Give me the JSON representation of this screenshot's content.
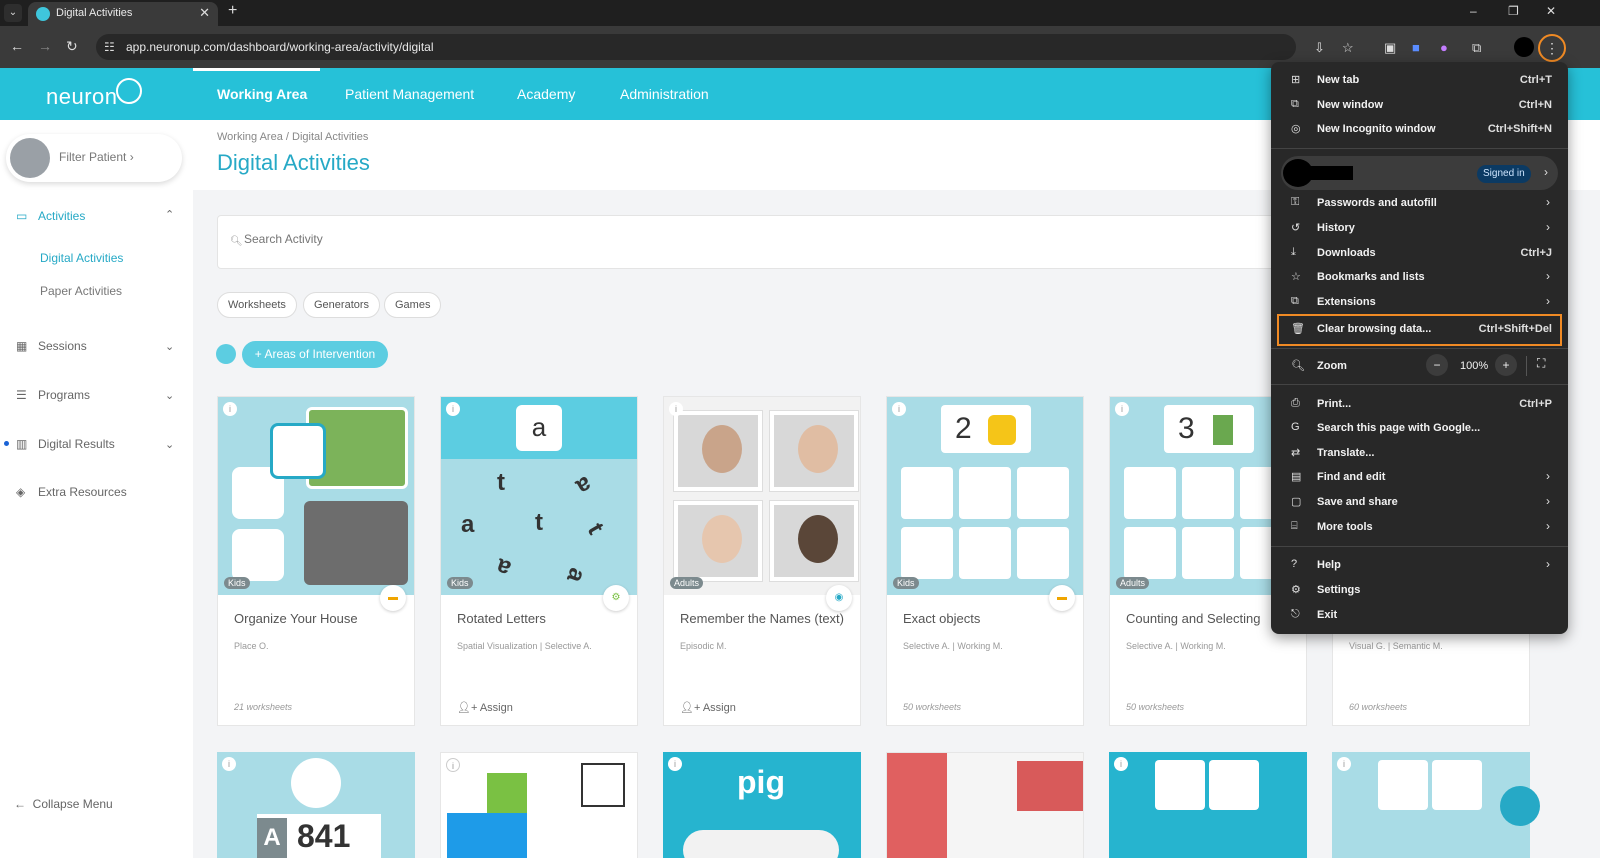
{
  "browser": {
    "tab_title": "Digital Activities",
    "tab_close": "✕",
    "new_tab": "+",
    "url": "app.neuronup.com/dashboard/working-area/activity/digital",
    "window": {
      "minimize": "–",
      "restore": "❐",
      "close": "✕"
    }
  },
  "app": {
    "logo": "neuron",
    "nav": [
      "Working Area",
      "Patient Management",
      "Academy",
      "Administration"
    ]
  },
  "sidebar": {
    "filter_patient": "Filter Patient  ›",
    "activities": "Activities",
    "sub": [
      "Digital Activities",
      "Paper Activities"
    ],
    "sessions": "Sessions",
    "programs": "Programs",
    "digital_results": "Digital Results",
    "extra_resources": "Extra Resources",
    "collapse": "Collapse Menu"
  },
  "main": {
    "breadcrumb": "Working Area /  Digital Activities",
    "title": "Digital Activities",
    "search_placeholder": "Search Activity",
    "chips": [
      "Worksheets",
      "Generators",
      "Games"
    ],
    "areas_button": "+ Areas of Intervention"
  },
  "cards": [
    {
      "title": "Organize Your House",
      "sub": "Place O.",
      "age": "Kids",
      "foot": "21 worksheets"
    },
    {
      "title": "Rotated Letters",
      "sub": "Spatial Visualization | Selective A.",
      "age": "Kids",
      "foot": "Assign"
    },
    {
      "title": "Remember the Names (text)",
      "sub": "Episodic M.",
      "age": "Adults",
      "foot": "Assign"
    },
    {
      "title": "Exact objects",
      "sub": "Selective A. | Working M.",
      "age": "Kids",
      "foot": "50 worksheets"
    },
    {
      "title": "Counting and Selecting",
      "sub": "Selective A. | Working M.",
      "age": "Adults",
      "foot": "50 worksheets"
    },
    {
      "title": "",
      "sub": "Visual G. | Semantic M.",
      "age": "",
      "foot": "60 worksheets"
    }
  ],
  "card_art": {
    "letter_a": "a",
    "number_2": "2",
    "number_3": "3",
    "pig": "pig",
    "num_841": "841",
    "letter_A": "A"
  },
  "menu": {
    "items_top": [
      {
        "label": "New tab",
        "shortcut": "Ctrl+T",
        "icon": "new-tab-icon"
      },
      {
        "label": "New window",
        "shortcut": "Ctrl+N",
        "icon": "new-window-icon"
      },
      {
        "label": "New Incognito window",
        "shortcut": "Ctrl+Shift+N",
        "icon": "incognito-icon"
      }
    ],
    "signed_in": "Signed in",
    "items_mid": [
      {
        "label": "Passwords and autofill",
        "shortcut": "›"
      },
      {
        "label": "History",
        "shortcut": "›"
      },
      {
        "label": "Downloads",
        "shortcut": "Ctrl+J"
      },
      {
        "label": "Bookmarks and lists",
        "shortcut": "›"
      },
      {
        "label": "Extensions",
        "shortcut": "›"
      },
      {
        "label": "Clear browsing data...",
        "shortcut": "Ctrl+Shift+Del"
      }
    ],
    "zoom": {
      "label": "Zoom",
      "minus": "−",
      "value": "100%",
      "plus": "+"
    },
    "items_low": [
      {
        "label": "Print...",
        "shortcut": "Ctrl+P"
      },
      {
        "label": "Search this page with Google...",
        "shortcut": ""
      },
      {
        "label": "Translate...",
        "shortcut": ""
      },
      {
        "label": "Find and edit",
        "shortcut": "›"
      },
      {
        "label": "Save and share",
        "shortcut": "›"
      },
      {
        "label": "More tools",
        "shortcut": "›"
      }
    ],
    "items_bottom": [
      {
        "label": "Help",
        "shortcut": "›"
      },
      {
        "label": "Settings",
        "shortcut": ""
      },
      {
        "label": "Exit",
        "shortcut": ""
      }
    ]
  },
  "colors": {
    "brand": "#26c1d8",
    "accent": "#26a9c6",
    "highlight": "#f08a24"
  }
}
